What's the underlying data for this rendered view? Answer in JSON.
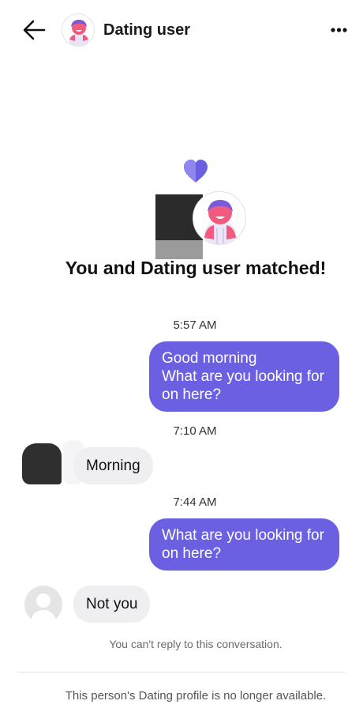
{
  "header": {
    "back_icon": "arrow-left-icon",
    "title": "Dating user",
    "more_icon": "more-horizontal-icon"
  },
  "match": {
    "icon": "heart-icon",
    "title": "You and Dating user matched!"
  },
  "messages": [
    {
      "time": "5:57 AM",
      "direction": "outgoing",
      "lines": [
        "Good morning",
        "What are you looking for",
        "on here?"
      ]
    },
    {
      "time": "7:10 AM",
      "direction": "incoming",
      "lines": [
        "Morning"
      ]
    },
    {
      "time": "7:44 AM",
      "direction": "outgoing",
      "lines": [
        "What are you looking for",
        "on here?"
      ]
    },
    {
      "direction": "incoming",
      "lines": [
        "Not you"
      ]
    }
  ],
  "footer": {
    "notice": "You can't reply to this conversation.",
    "profile_note": "This person's Dating profile is no longer available."
  },
  "colors": {
    "outgoing_bubble": "#6b5fe2",
    "incoming_bubble": "#efeff2",
    "heart": "#6a5fe0"
  }
}
